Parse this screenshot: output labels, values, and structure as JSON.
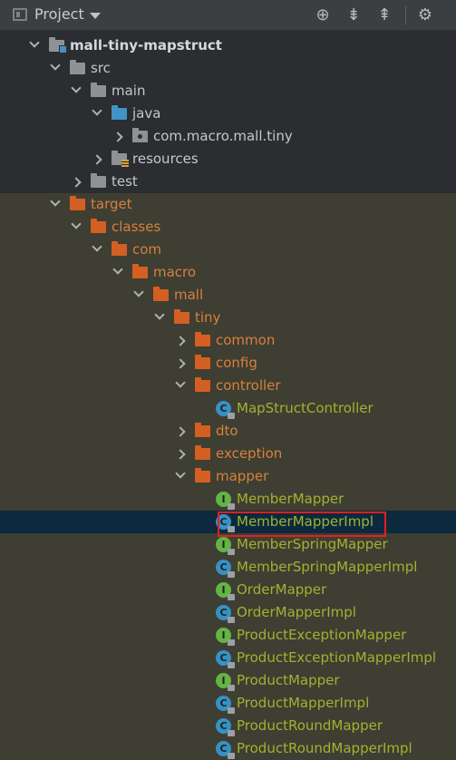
{
  "toolbar": {
    "title": "Project",
    "icons": [
      "target-icon",
      "expand-all-icon",
      "collapse-all-icon",
      "gear-icon"
    ]
  },
  "tree": [
    {
      "label": "mall-tiny-mapstruct",
      "arrow": "down",
      "kind": "module",
      "depth": 0
    },
    {
      "label": "src",
      "arrow": "down",
      "kind": "folder",
      "depth": 1
    },
    {
      "label": "main",
      "arrow": "down",
      "kind": "folder",
      "depth": 2
    },
    {
      "label": "java",
      "arrow": "down",
      "kind": "blue",
      "depth": 3
    },
    {
      "label": "com.macro.mall.tiny",
      "arrow": "right",
      "kind": "pkg",
      "depth": 4
    },
    {
      "label": "resources",
      "arrow": "right",
      "kind": "res",
      "depth": 3
    },
    {
      "label": "test",
      "arrow": "right",
      "kind": "folder",
      "depth": 2
    },
    {
      "label": "target",
      "arrow": "down",
      "kind": "orange",
      "depth": 1
    },
    {
      "label": "classes",
      "arrow": "down",
      "kind": "orange",
      "depth": 2
    },
    {
      "label": "com",
      "arrow": "down",
      "kind": "orange",
      "depth": 3
    },
    {
      "label": "macro",
      "arrow": "down",
      "kind": "orange",
      "depth": 4
    },
    {
      "label": "mall",
      "arrow": "down",
      "kind": "orange",
      "depth": 5
    },
    {
      "label": "tiny",
      "arrow": "down",
      "kind": "orange",
      "depth": 6
    },
    {
      "label": "common",
      "arrow": "right",
      "kind": "orange",
      "depth": 7
    },
    {
      "label": "config",
      "arrow": "right",
      "kind": "orange",
      "depth": 7
    },
    {
      "label": "controller",
      "arrow": "down",
      "kind": "orange",
      "depth": 7
    },
    {
      "label": "MapStructController",
      "arrow": "",
      "kind": "class",
      "depth": 8
    },
    {
      "label": "dto",
      "arrow": "right",
      "kind": "orange",
      "depth": 7
    },
    {
      "label": "exception",
      "arrow": "right",
      "kind": "orange",
      "depth": 7
    },
    {
      "label": "mapper",
      "arrow": "down",
      "kind": "orange",
      "depth": 7
    },
    {
      "label": "MemberMapper",
      "arrow": "",
      "kind": "interface",
      "depth": 8
    },
    {
      "label": "MemberMapperImpl",
      "arrow": "",
      "kind": "class",
      "depth": 8
    },
    {
      "label": "MemberSpringMapper",
      "arrow": "",
      "kind": "interface",
      "depth": 8
    },
    {
      "label": "MemberSpringMapperImpl",
      "arrow": "",
      "kind": "class",
      "depth": 8
    },
    {
      "label": "OrderMapper",
      "arrow": "",
      "kind": "interface",
      "depth": 8
    },
    {
      "label": "OrderMapperImpl",
      "arrow": "",
      "kind": "class",
      "depth": 8
    },
    {
      "label": "ProductExceptionMapper",
      "arrow": "",
      "kind": "interface",
      "depth": 8
    },
    {
      "label": "ProductExceptionMapperImpl",
      "arrow": "",
      "kind": "class",
      "depth": 8
    },
    {
      "label": "ProductMapper",
      "arrow": "",
      "kind": "interface",
      "depth": 8
    },
    {
      "label": "ProductMapperImpl",
      "arrow": "",
      "kind": "class",
      "depth": 8
    },
    {
      "label": "ProductRoundMapper",
      "arrow": "",
      "kind": "class",
      "depth": 8
    },
    {
      "label": "ProductRoundMapperImpl",
      "arrow": "",
      "kind": "class",
      "depth": 8
    }
  ],
  "selected_item": "MemberMapperImpl",
  "colors": {
    "excluded_folder": "#d45f22",
    "excluded_text": "#d6813e",
    "generated_file_text": "#9fb330",
    "selection_bg": "#0d293e",
    "highlight_border": "#e02020"
  }
}
